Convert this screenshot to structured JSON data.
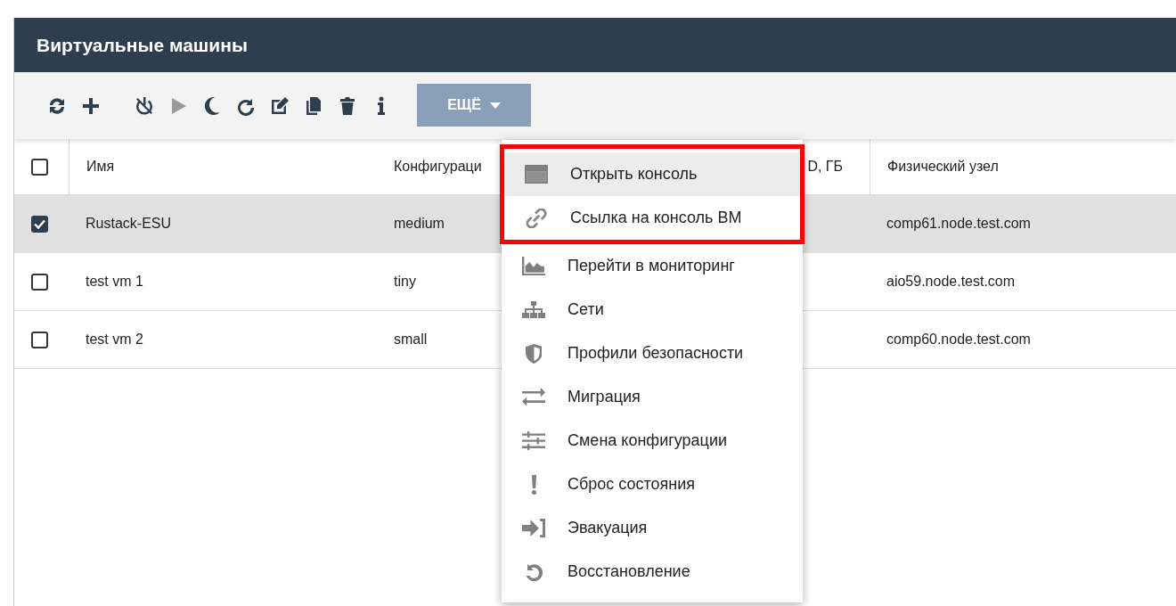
{
  "panel": {
    "title": "Виртуальные машины"
  },
  "toolbar": {
    "tools": [
      {
        "disabled": false
      },
      {
        "disabled": false
      },
      {
        "disabled": false
      },
      {
        "disabled": true
      },
      {
        "disabled": false
      },
      {
        "disabled": false
      },
      {
        "disabled": false
      },
      {
        "disabled": false
      },
      {
        "disabled": false
      },
      {
        "disabled": false
      }
    ],
    "more_button": {
      "label": "ЕЩЁ",
      "expanded": true
    }
  },
  "table": {
    "header_checkbox": {
      "checked": false
    },
    "columns": [
      "Имя",
      "Конфигураци",
      "D, ГБ",
      "Физический узел"
    ],
    "rows": [
      {
        "checked": true,
        "selected": true,
        "name": "Rustack-ESU",
        "configuration": "medium",
        "host": "comp61.node.test.com"
      },
      {
        "checked": false,
        "selected": false,
        "name": "test vm 1",
        "configuration": "tiny",
        "host": "aio59.node.test.com"
      },
      {
        "checked": false,
        "selected": false,
        "name": "test vm 2",
        "configuration": "small",
        "host": "comp60.node.test.com"
      }
    ]
  },
  "menu": {
    "items": [
      {
        "label": "Открыть консоль",
        "selected": true,
        "highlighted": true
      },
      {
        "label": "Ссылка на консоль ВМ",
        "selected": false,
        "highlighted": true
      },
      {
        "label": "Перейти в мониторинг",
        "selected": false,
        "highlighted": false
      },
      {
        "label": "Сети",
        "selected": false,
        "highlighted": false
      },
      {
        "label": "Профили безопасности",
        "selected": false,
        "highlighted": false
      },
      {
        "label": "Миграция",
        "selected": false,
        "highlighted": false
      },
      {
        "label": "Смена конфигурации",
        "selected": false,
        "highlighted": false
      },
      {
        "label": "Сброс состояния",
        "selected": false,
        "highlighted": false
      },
      {
        "label": "Эвакуация",
        "selected": false,
        "highlighted": false
      },
      {
        "label": "Восстановление",
        "selected": false,
        "highlighted": false
      }
    ]
  }
}
